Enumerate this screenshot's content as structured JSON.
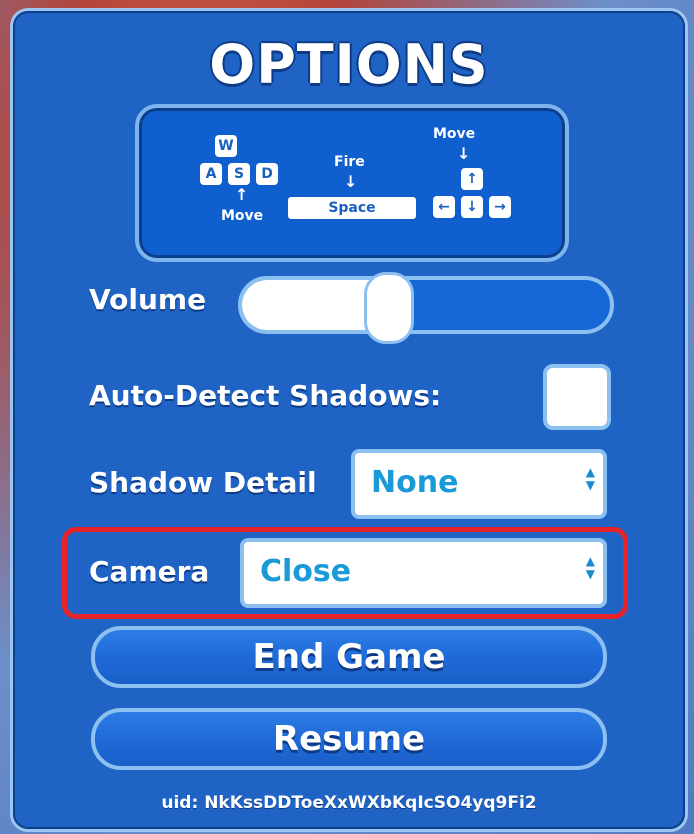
{
  "title": "OPTIONS",
  "controls": {
    "keys_wasd": [
      "W",
      "A",
      "S",
      "D"
    ],
    "wasd_label": "Move",
    "fire_label": "Fire",
    "space_label": "Space",
    "arrows_label": "Move",
    "arrow_keys": [
      "↑",
      "←",
      "↓",
      "→"
    ]
  },
  "volume": {
    "label": "Volume",
    "level": 0.4
  },
  "auto_detect_shadows": {
    "label": "Auto-Detect Shadows:",
    "checked": false
  },
  "shadow_detail": {
    "label": "Shadow Detail",
    "value": "None"
  },
  "camera": {
    "label": "Camera",
    "value": "Close"
  },
  "buttons": {
    "end_game": "End Game",
    "resume": "Resume"
  },
  "uid": "uid: NkKssDDToeXxWXbKqIcSO4yq9Fi2",
  "colors": {
    "panel": "#1f63c4",
    "border": "#8cc0f0",
    "highlight": "#e8232a",
    "select_text": "#1a9ad6"
  }
}
